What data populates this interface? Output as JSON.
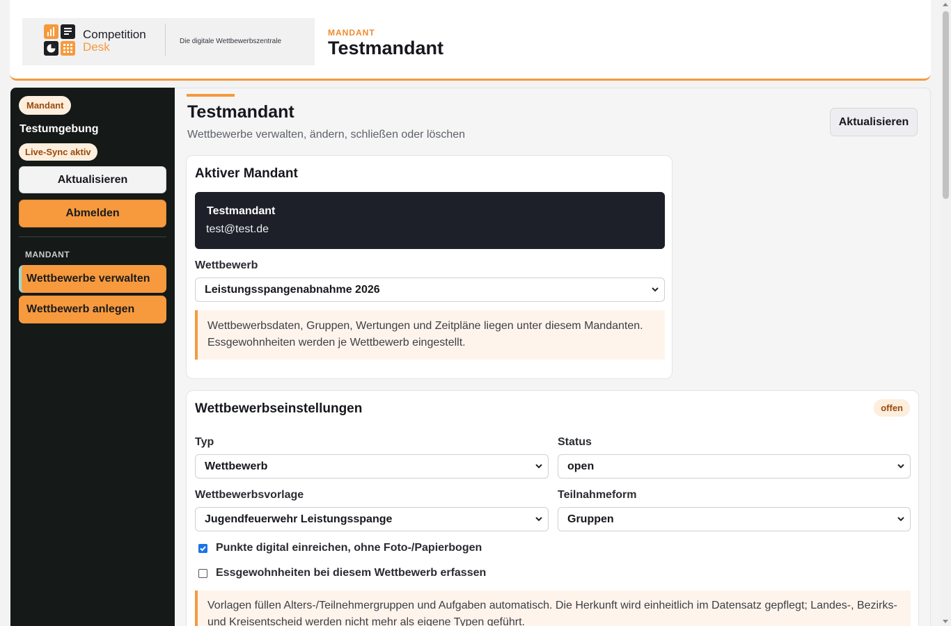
{
  "header": {
    "logo": {
      "name_line1": "Competition",
      "name_line2": "Desk",
      "tagline": "Die digitale Wettbewerbszentrale"
    },
    "kicker": "MANDANT",
    "title": "Testmandant"
  },
  "sidebar": {
    "role_badge": "Mandant",
    "environment": "Testumgebung",
    "sync_badge": "Live-Sync aktiv",
    "refresh_label": "Aktualisieren",
    "logout_label": "Abmelden",
    "section_label": "MANDANT",
    "nav": [
      {
        "label": "Wettbewerbe verwalten",
        "active": true
      },
      {
        "label": "Wettbewerb anlegen",
        "active": false
      }
    ]
  },
  "page": {
    "title": "Testmandant",
    "subtitle": "Wettbewerbe verwalten, ändern, schließen oder löschen",
    "refresh_label": "Aktualisieren"
  },
  "active_mandant": {
    "title": "Aktiver Mandant",
    "name": "Testmandant",
    "email": "test@test.de",
    "competition_label": "Wettbewerb",
    "competition_value": "Leistungsspangenabnahme 2026",
    "note": "Wettbewerbsdaten, Gruppen, Wertungen und Zeitpläne liegen unter diesem Mandanten. Essgewohnheiten werden je Wettbewerb eingestellt."
  },
  "settings": {
    "title": "Wettbewerbseinstellungen",
    "status_badge": "offen",
    "type_label": "Typ",
    "type_value": "Wettbewerb",
    "status_label": "Status",
    "status_value": "open",
    "template_label": "Wettbewerbsvorlage",
    "template_value": "Jugendfeuerwehr Leistungsspange",
    "participation_label": "Teilnahmeform",
    "participation_value": "Gruppen",
    "checkbox_digital": {
      "label": "Punkte digital einreichen, ohne Foto-/Papierbogen",
      "checked": true
    },
    "checkbox_food": {
      "label": "Essgewohnheiten bei diesem Wettbewerb erfassen",
      "checked": false
    },
    "note": "Vorlagen füllen Alters-/Teilnehmergruppen und Aufgaben automatisch. Die Herkunft wird einheitlich im Datensatz gepflegt; Landes-, Bezirks- und Kreisentscheid werden nicht mehr als eigene Typen geführt."
  },
  "colors": {
    "accent": "#f59a3c",
    "sidebar_bg": "#151918",
    "dark_box": "#1d2028"
  }
}
